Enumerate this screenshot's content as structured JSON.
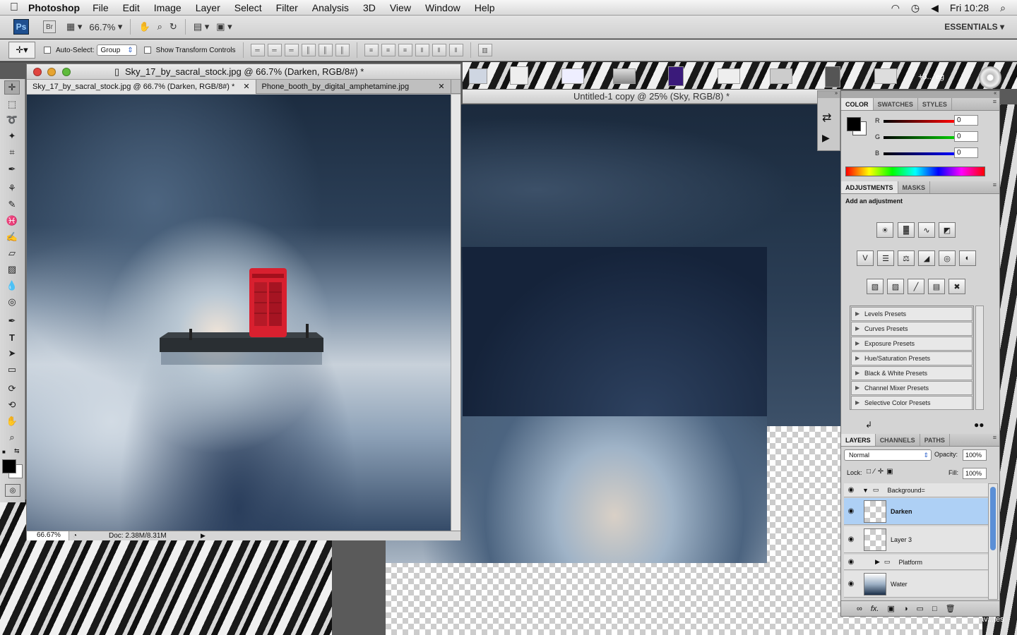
{
  "menubar": {
    "app_name": "Photoshop",
    "items": [
      "File",
      "Edit",
      "Image",
      "Layer",
      "Select",
      "Filter",
      "Analysis",
      "3D",
      "View",
      "Window",
      "Help"
    ],
    "clock": "Fri 10:28"
  },
  "appbar": {
    "ps_label": "Ps",
    "br_label": "Br",
    "zoom": "66.7%",
    "workspace": "ESSENTIALS"
  },
  "options": {
    "auto_select_label": "Auto-Select:",
    "auto_select_value": "Group",
    "transform_label": "Show Transform Controls"
  },
  "document_main": {
    "title": "Sky_17_by_sacral_stock.jpg @ 66.7% (Darken, RGB/8#) *",
    "tabs": [
      {
        "label": "Sky_17_by_sacral_stock.jpg @ 66.7% (Darken, RGB/8#) *"
      },
      {
        "label": "Phone_booth_by_digital_amphetamine.jpg"
      }
    ],
    "status_zoom": "66.67%",
    "status_doc": "Doc: 2.38M/8.31M"
  },
  "document_bg": {
    "title": "Untitled-1 copy @ 25% (Sky, RGB/8) *"
  },
  "thumb_caption": "+3... eg",
  "desktop_caption": "av...tes",
  "color_panel": {
    "tabs": [
      "COLOR",
      "SWATCHES",
      "STYLES"
    ],
    "channels": [
      {
        "label": "R",
        "value": "0",
        "color": "#d00000"
      },
      {
        "label": "G",
        "value": "0",
        "color": "#00a000"
      },
      {
        "label": "B",
        "value": "0",
        "color": "#0000d0"
      }
    ]
  },
  "adjustments_panel": {
    "tabs": [
      "ADJUSTMENTS",
      "MASKS"
    ],
    "heading": "Add an adjustment",
    "presets": [
      "Levels Presets",
      "Curves Presets",
      "Exposure Presets",
      "Hue/Saturation Presets",
      "Black & White Presets",
      "Channel Mixer Presets",
      "Selective Color Presets"
    ]
  },
  "layers_panel": {
    "tabs": [
      "LAYERS",
      "CHANNELS",
      "PATHS"
    ],
    "blend_mode": "Normal",
    "opacity_label": "Opacity:",
    "opacity_value": "100%",
    "lock_label": "Lock:",
    "fill_label": "Fill:",
    "fill_value": "100%",
    "group_name": "Background=",
    "layers": [
      {
        "name": "Darken"
      },
      {
        "name": "Layer 3"
      },
      {
        "name": "Platform"
      },
      {
        "name": "Water"
      }
    ],
    "fx_label": "fx."
  },
  "colors": {
    "accent_selected": "#aed0f5",
    "booth_red": "#d8202f"
  }
}
